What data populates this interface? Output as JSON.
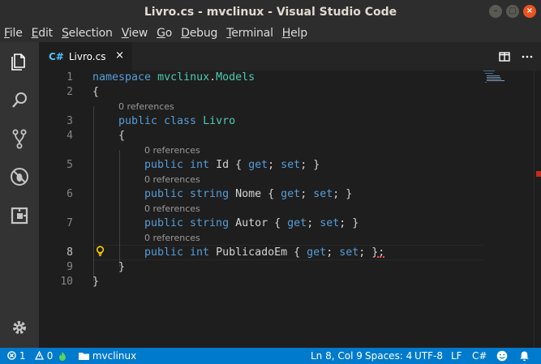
{
  "window": {
    "title": "Livro.cs - mvclinux - Visual Studio Code"
  },
  "menu": [
    "File",
    "Edit",
    "Selection",
    "View",
    "Go",
    "Debug",
    "Terminal",
    "Help"
  ],
  "activity_bar": [
    "files-icon",
    "search-icon",
    "source-control-icon",
    "debug-icon",
    "extensions-icon",
    "settings-gear-icon"
  ],
  "tab": {
    "label": "Livro.cs",
    "icon": "C#",
    "close": "×"
  },
  "editor": {
    "line_numbers": [
      "1",
      "2",
      "3",
      "4",
      "5",
      "6",
      "7",
      "8",
      "9",
      "10"
    ],
    "codelens": [
      "0 references",
      "0 references",
      "0 references",
      "0 references",
      "0 references"
    ],
    "lines": {
      "l1_kw": "namespace",
      "l1_ns": "mvclinux",
      "l1_dot": ".",
      "l1_models": "Models",
      "l2": "{",
      "l3_kw": "public class",
      "l3_name": "Livro",
      "l4": "{",
      "l5_kw": "public int",
      "l5_name": "Id",
      "l5_b1": "{ ",
      "l5_get": "get",
      "l5_mid": "; ",
      "l5_set": "set",
      "l5_end": "; }",
      "l6_kw": "public string",
      "l6_name": "Nome",
      "l6_b1": "{ ",
      "l6_get": "get",
      "l6_mid": "; ",
      "l6_set": "set",
      "l6_end": "; }",
      "l7_kw": "public string",
      "l7_name": "Autor",
      "l7_b1": "{ ",
      "l7_get": "get",
      "l7_mid": "; ",
      "l7_set": "set",
      "l7_end": "; }",
      "l8_kw": "public int",
      "l8_name": "PublicadoEm",
      "l8_b1": "{ ",
      "l8_get": "get",
      "l8_mid": "; ",
      "l8_set": "set",
      "l8_end": "; };",
      "l9": "}",
      "l10": "}"
    }
  },
  "status": {
    "errors": "1",
    "warnings": "0",
    "folder": "mvclinux",
    "position": "Ln 8, Col 9",
    "spaces": "Spaces: 4",
    "encoding": "UTF-8",
    "eol": "LF",
    "language": "C#"
  },
  "colors": {
    "statusbar": "#007acc",
    "keyword": "#569cd6",
    "type": "#4ec9b0",
    "identifier": "#9cdcfe"
  }
}
